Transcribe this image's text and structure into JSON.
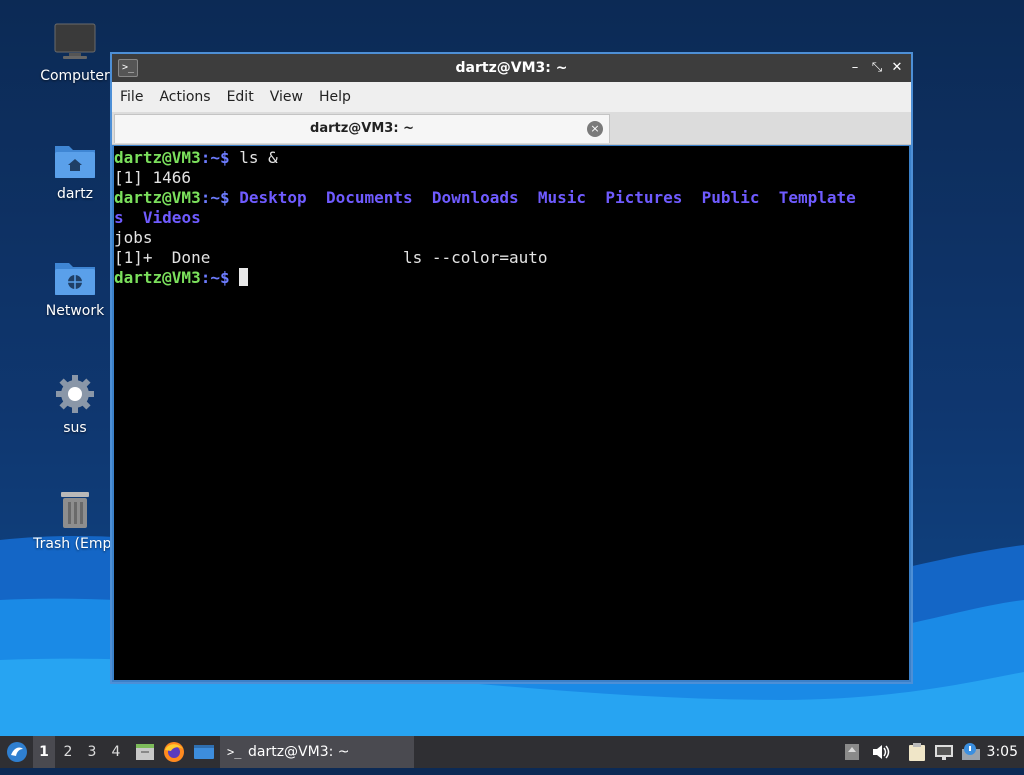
{
  "desktop": {
    "icons": [
      {
        "label": "Computer",
        "icon": "computer-icon"
      },
      {
        "label": "dartz",
        "icon": "home-folder-icon"
      },
      {
        "label": "Network",
        "icon": "network-folder-icon"
      },
      {
        "label": "sus",
        "icon": "gear-icon"
      },
      {
        "label": "Trash (Empt",
        "icon": "trash-icon"
      }
    ]
  },
  "window": {
    "title": "dartz@VM3: ~",
    "controls": {
      "minimize": "–",
      "restore": "⤡",
      "close": "✕"
    },
    "menu": [
      "File",
      "Actions",
      "Edit",
      "View",
      "Help"
    ],
    "tab": {
      "label": "dartz@VM3: ~",
      "close": "×"
    }
  },
  "terminal": {
    "prompt_user": "dartz@VM3",
    "prompt_path": ":~$",
    "cmd1": " ls &",
    "job_line": "[1] 1466",
    "dirs": [
      "Desktop",
      "Documents",
      "Downloads",
      "Music",
      "Pictures",
      "Public",
      "Template",
      "s",
      "Videos"
    ],
    "cmd_jobs": "jobs",
    "done_line": "[1]+  Done                    ls --color=auto"
  },
  "taskbar": {
    "workspaces": [
      "1",
      "2",
      "3",
      "4"
    ],
    "active_workspace": "1",
    "task_label": "dartz@VM3: ~",
    "clock": "3:05"
  },
  "colors": {
    "prompt_user": "#7be05c",
    "prompt_path": "#6d7cff",
    "directory": "#6f5bff",
    "window_border": "#4d8fd6"
  }
}
